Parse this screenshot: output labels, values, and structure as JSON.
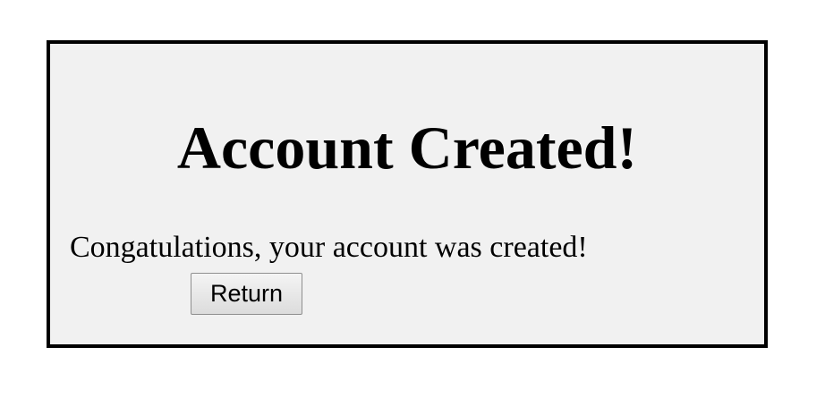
{
  "page": {
    "title": "Account Created!",
    "message": "Congatulations, your account was created!",
    "return_label": "Return"
  },
  "colors": {
    "panel_background": "#f1f1f1",
    "panel_border": "#000000",
    "text": "#000000"
  }
}
